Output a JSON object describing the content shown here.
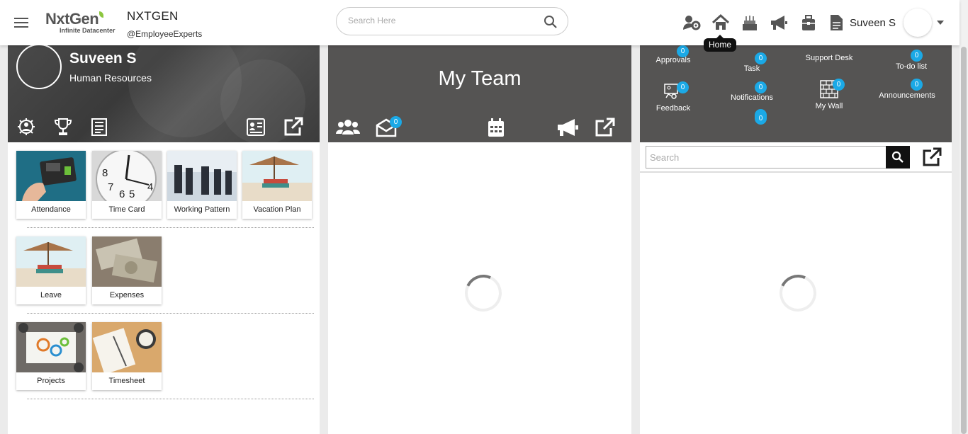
{
  "header": {
    "logo_text": "NxtGen",
    "logo_tagline": "Infinite Datacenter",
    "org_name": "NXTGEN",
    "org_handle": "@EmployeeExperts",
    "search_placeholder": "Search Here",
    "user_name": "Suveen S",
    "tooltip": "Home",
    "icons": [
      "team-settings-icon",
      "home-icon",
      "birthday-cake-icon",
      "megaphone-icon",
      "briefcase-icon",
      "document-icon"
    ]
  },
  "profile": {
    "name": "Suveen S",
    "role": "Human Resources",
    "icons": [
      "user-settings-icon",
      "trophy-icon",
      "newspaper-icon",
      "id-card-icon",
      "external-link-icon"
    ]
  },
  "tiles": [
    {
      "label": "Attendance"
    },
    {
      "label": "Time Card"
    },
    {
      "label": "Working Pattern"
    },
    {
      "label": "Vacation Plan"
    },
    {
      "label": "Leave"
    },
    {
      "label": "Expenses"
    },
    {
      "label": "Projects"
    },
    {
      "label": "Timesheet"
    }
  ],
  "team": {
    "title": "My Team",
    "inbox_badge": "0",
    "icons": [
      "team-icon",
      "inbox-icon",
      "calendar-icon",
      "megaphone-icon",
      "external-link-icon"
    ]
  },
  "workspace": {
    "items": [
      {
        "label": "Approvals",
        "badge": "0"
      },
      {
        "label": "Task",
        "badge": "0"
      },
      {
        "label": "Support Desk"
      },
      {
        "label": "To-do list",
        "badge": "0"
      },
      {
        "label": "Feedback",
        "badge": "0"
      },
      {
        "label": "Notifications",
        "badge": "0"
      },
      {
        "label": "My Wall",
        "badge": "0"
      },
      {
        "label": "Announcements",
        "badge": "0"
      },
      {
        "label": "",
        "badge": "0"
      }
    ],
    "search_placeholder": "Search"
  },
  "colors": {
    "banner": "#555453",
    "badge": "#1ba9e6",
    "logo_leaf": "#8cc63f"
  }
}
